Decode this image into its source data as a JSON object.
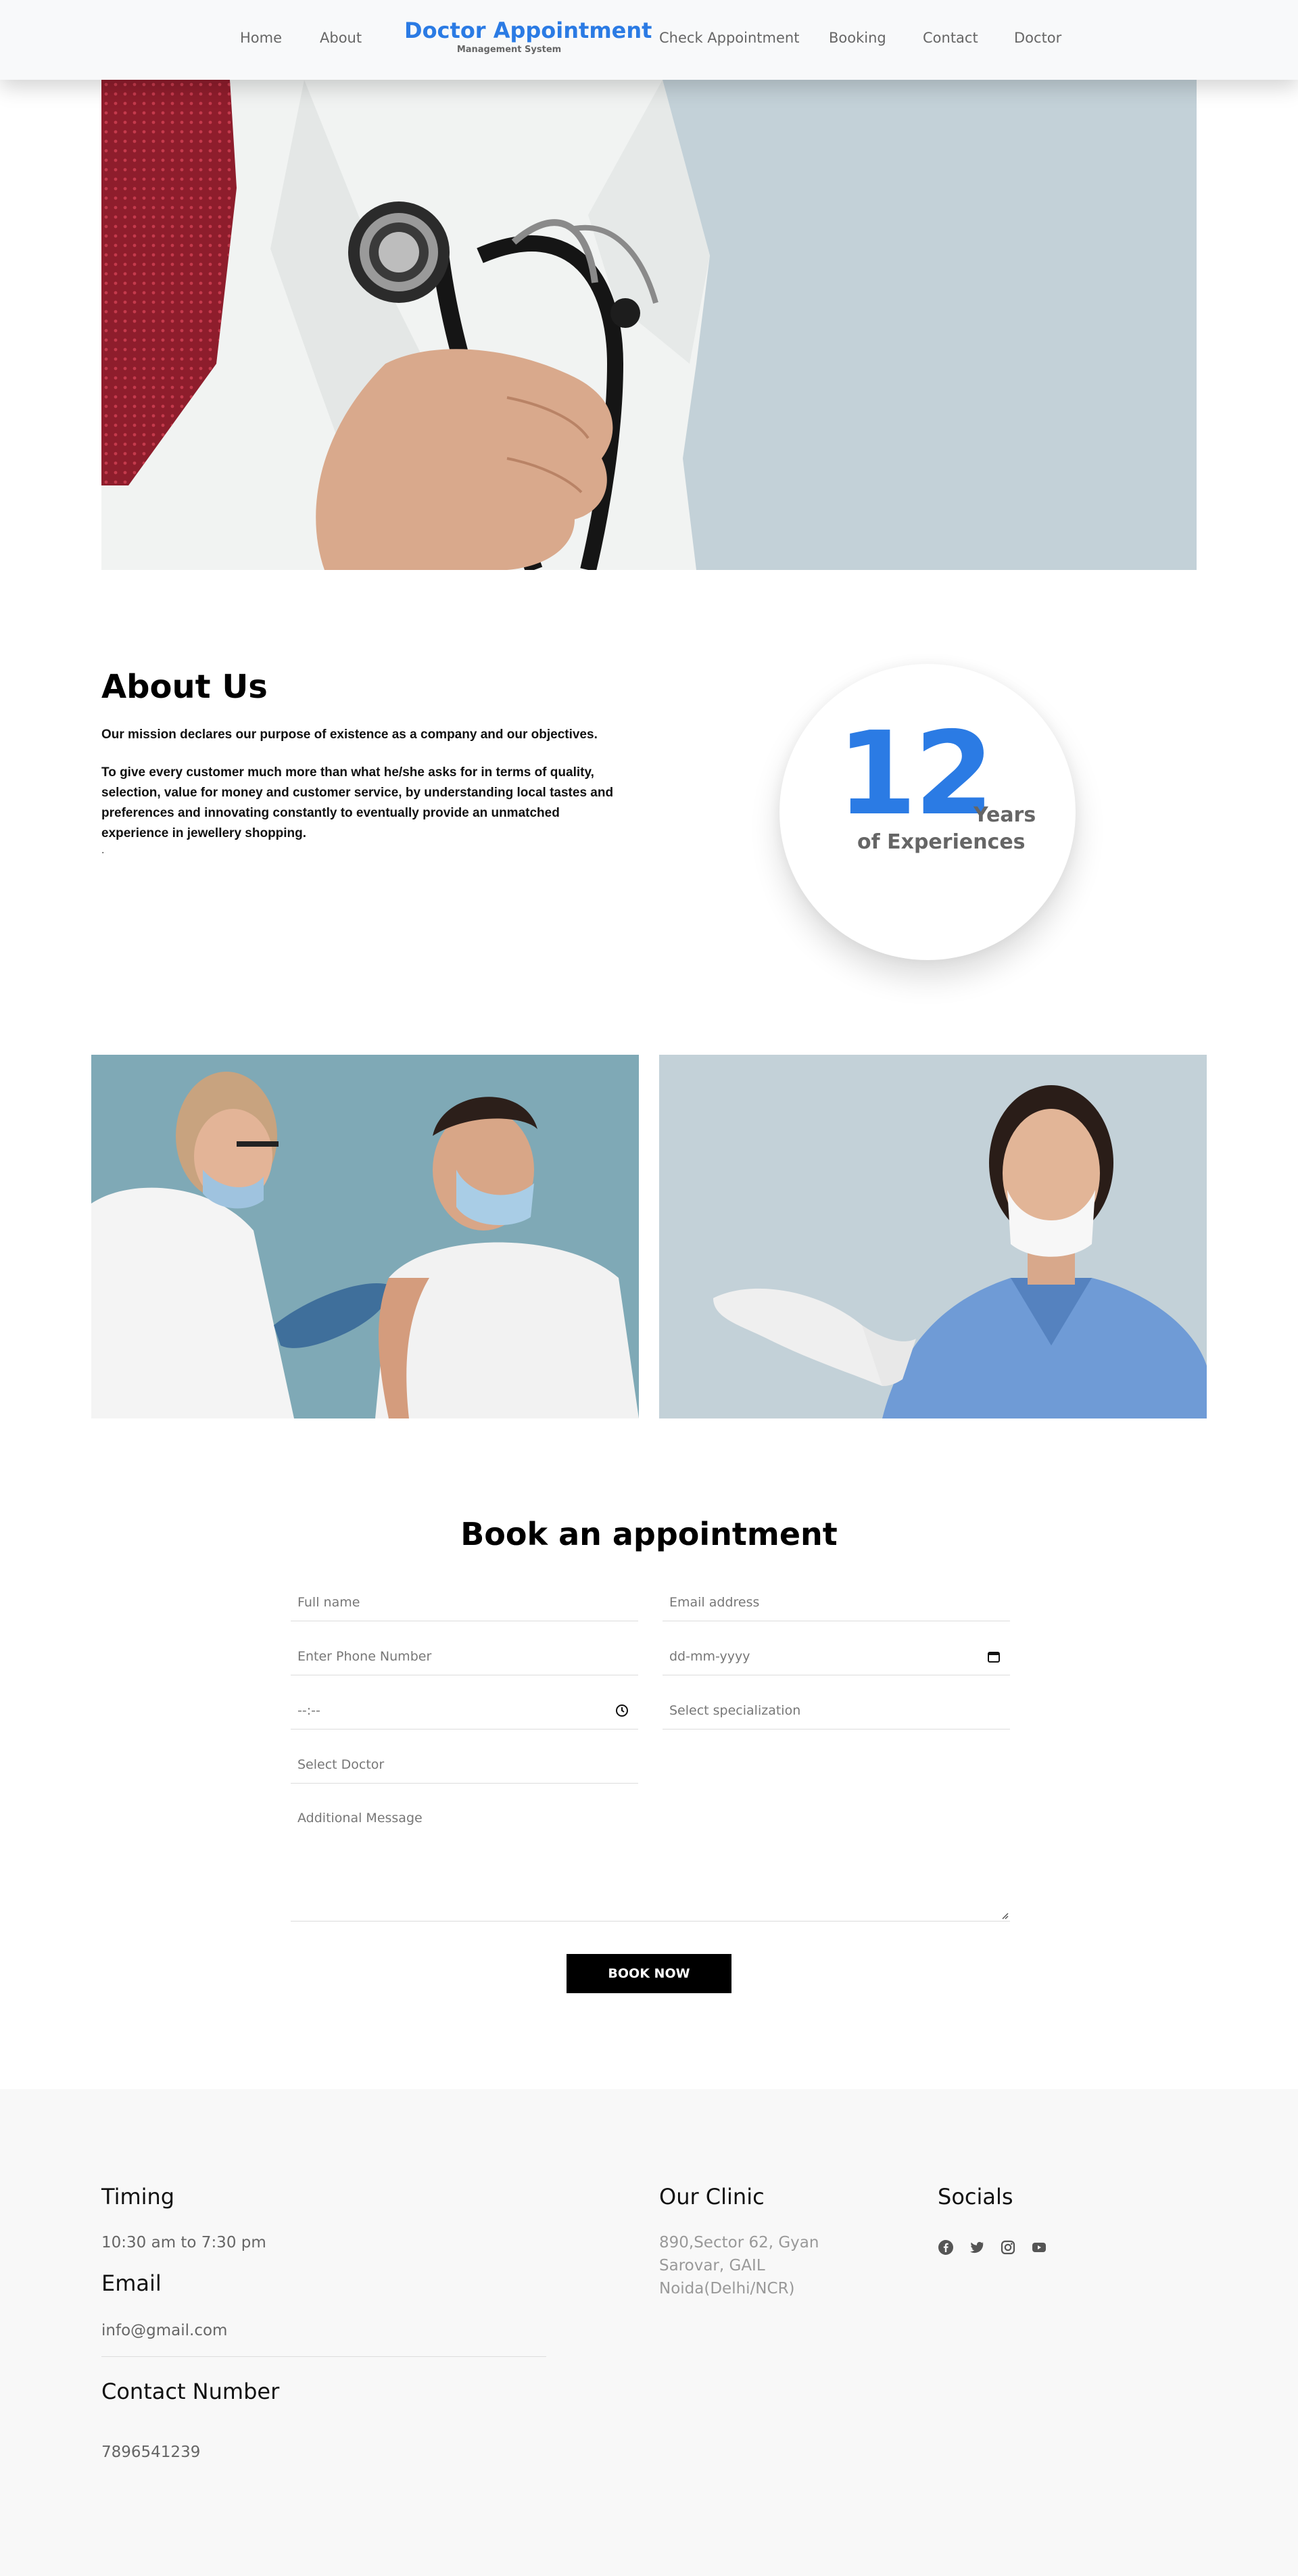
{
  "nav": {
    "links_left": [
      "Home",
      "About"
    ],
    "brand_title": "Doctor Appointment",
    "brand_subtitle": "Management System",
    "links_right": [
      "Check Appointment",
      "Booking",
      "Contact",
      "Doctor"
    ]
  },
  "about": {
    "title": "About Us",
    "p1": "Our mission declares our purpose of existence as a company and our objectives.",
    "p2": "To give every customer much more than what he/she asks for in terms of quality, selection, value for money and customer service, by understanding local tastes and preferences and innovating constantly to eventually provide an unmatched experience in jewellery shopping.",
    "trailing": ".",
    "experience": {
      "number": "12",
      "years_label": "Years",
      "sub_label": "of Experiences"
    }
  },
  "booking": {
    "title": "Book an appointment",
    "full_name_placeholder": "Full name",
    "email_placeholder": "Email address",
    "phone_placeholder": "Enter Phone Number",
    "date_placeholder": "dd-mm-yyyy",
    "time_placeholder": "--:--",
    "specialization_placeholder": "Select specialization",
    "doctor_placeholder": "Select Doctor",
    "message_placeholder": "Additional Message",
    "submit_label": "BOOK NOW"
  },
  "footer": {
    "timing_title": "Timing",
    "timing_value": "10:30 am to 7:30 pm",
    "email_title": "Email",
    "email_value": "info@gmail.com",
    "contact_title": "Contact Number",
    "contact_value": "7896541239",
    "clinic_title": "Our Clinic",
    "clinic_address": [
      "890,Sector 62, Gyan",
      "Sarovar, GAIL",
      "Noida(Delhi/NCR)"
    ],
    "socials_title": "Socials",
    "social_icons": [
      "facebook-icon",
      "twitter-icon",
      "instagram-icon",
      "youtube-icon"
    ]
  },
  "colors": {
    "accent": "#2b7be4",
    "hero_bg": "#c3d1d8",
    "footer_bg": "#f8f8f8",
    "button_bg": "#000000"
  }
}
